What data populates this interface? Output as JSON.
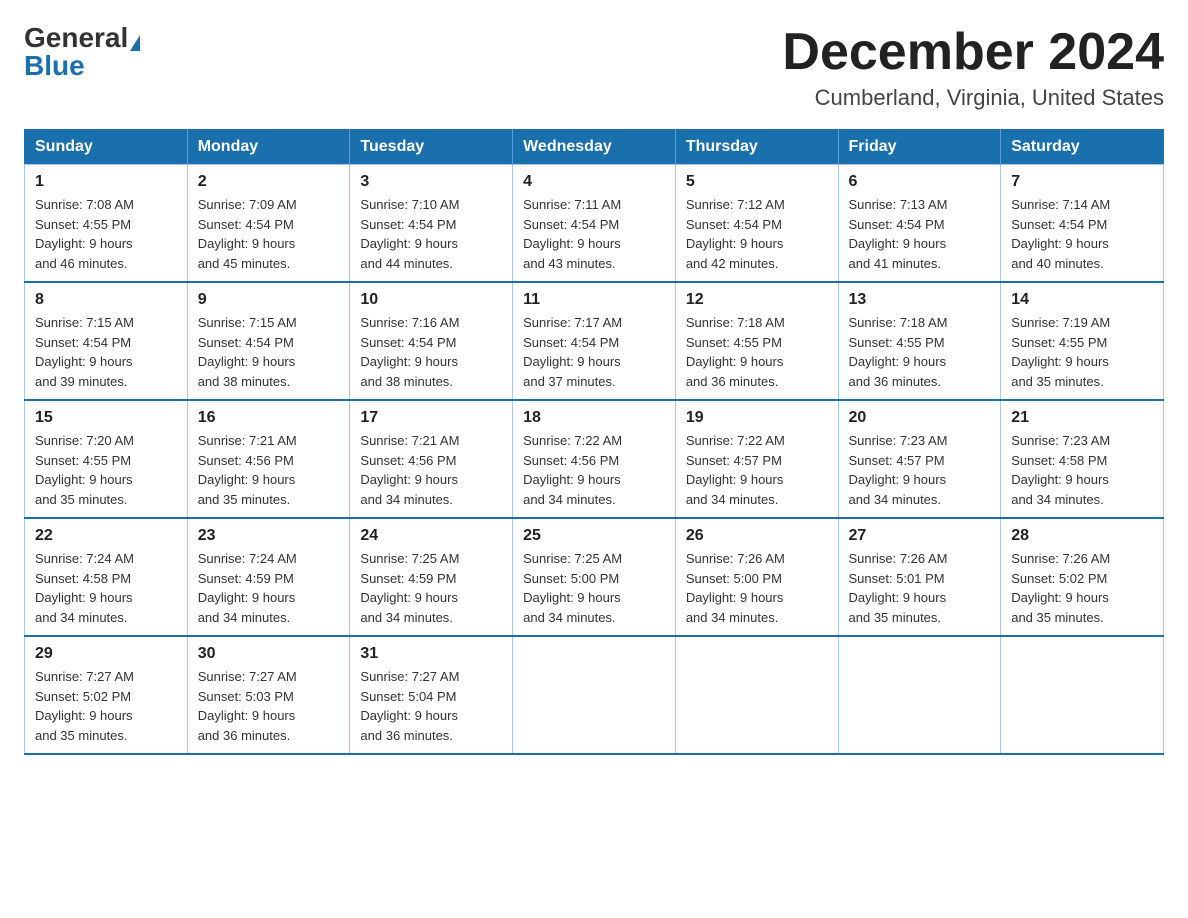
{
  "logo": {
    "general": "General",
    "blue": "Blue"
  },
  "title": "December 2024",
  "subtitle": "Cumberland, Virginia, United States",
  "weekdays": [
    "Sunday",
    "Monday",
    "Tuesday",
    "Wednesday",
    "Thursday",
    "Friday",
    "Saturday"
  ],
  "weeks": [
    [
      {
        "day": "1",
        "sunrise": "7:08 AM",
        "sunset": "4:55 PM",
        "daylight": "9 hours and 46 minutes."
      },
      {
        "day": "2",
        "sunrise": "7:09 AM",
        "sunset": "4:54 PM",
        "daylight": "9 hours and 45 minutes."
      },
      {
        "day": "3",
        "sunrise": "7:10 AM",
        "sunset": "4:54 PM",
        "daylight": "9 hours and 44 minutes."
      },
      {
        "day": "4",
        "sunrise": "7:11 AM",
        "sunset": "4:54 PM",
        "daylight": "9 hours and 43 minutes."
      },
      {
        "day": "5",
        "sunrise": "7:12 AM",
        "sunset": "4:54 PM",
        "daylight": "9 hours and 42 minutes."
      },
      {
        "day": "6",
        "sunrise": "7:13 AM",
        "sunset": "4:54 PM",
        "daylight": "9 hours and 41 minutes."
      },
      {
        "day": "7",
        "sunrise": "7:14 AM",
        "sunset": "4:54 PM",
        "daylight": "9 hours and 40 minutes."
      }
    ],
    [
      {
        "day": "8",
        "sunrise": "7:15 AM",
        "sunset": "4:54 PM",
        "daylight": "9 hours and 39 minutes."
      },
      {
        "day": "9",
        "sunrise": "7:15 AM",
        "sunset": "4:54 PM",
        "daylight": "9 hours and 38 minutes."
      },
      {
        "day": "10",
        "sunrise": "7:16 AM",
        "sunset": "4:54 PM",
        "daylight": "9 hours and 38 minutes."
      },
      {
        "day": "11",
        "sunrise": "7:17 AM",
        "sunset": "4:54 PM",
        "daylight": "9 hours and 37 minutes."
      },
      {
        "day": "12",
        "sunrise": "7:18 AM",
        "sunset": "4:55 PM",
        "daylight": "9 hours and 36 minutes."
      },
      {
        "day": "13",
        "sunrise": "7:18 AM",
        "sunset": "4:55 PM",
        "daylight": "9 hours and 36 minutes."
      },
      {
        "day": "14",
        "sunrise": "7:19 AM",
        "sunset": "4:55 PM",
        "daylight": "9 hours and 35 minutes."
      }
    ],
    [
      {
        "day": "15",
        "sunrise": "7:20 AM",
        "sunset": "4:55 PM",
        "daylight": "9 hours and 35 minutes."
      },
      {
        "day": "16",
        "sunrise": "7:21 AM",
        "sunset": "4:56 PM",
        "daylight": "9 hours and 35 minutes."
      },
      {
        "day": "17",
        "sunrise": "7:21 AM",
        "sunset": "4:56 PM",
        "daylight": "9 hours and 34 minutes."
      },
      {
        "day": "18",
        "sunrise": "7:22 AM",
        "sunset": "4:56 PM",
        "daylight": "9 hours and 34 minutes."
      },
      {
        "day": "19",
        "sunrise": "7:22 AM",
        "sunset": "4:57 PM",
        "daylight": "9 hours and 34 minutes."
      },
      {
        "day": "20",
        "sunrise": "7:23 AM",
        "sunset": "4:57 PM",
        "daylight": "9 hours and 34 minutes."
      },
      {
        "day": "21",
        "sunrise": "7:23 AM",
        "sunset": "4:58 PM",
        "daylight": "9 hours and 34 minutes."
      }
    ],
    [
      {
        "day": "22",
        "sunrise": "7:24 AM",
        "sunset": "4:58 PM",
        "daylight": "9 hours and 34 minutes."
      },
      {
        "day": "23",
        "sunrise": "7:24 AM",
        "sunset": "4:59 PM",
        "daylight": "9 hours and 34 minutes."
      },
      {
        "day": "24",
        "sunrise": "7:25 AM",
        "sunset": "4:59 PM",
        "daylight": "9 hours and 34 minutes."
      },
      {
        "day": "25",
        "sunrise": "7:25 AM",
        "sunset": "5:00 PM",
        "daylight": "9 hours and 34 minutes."
      },
      {
        "day": "26",
        "sunrise": "7:26 AM",
        "sunset": "5:00 PM",
        "daylight": "9 hours and 34 minutes."
      },
      {
        "day": "27",
        "sunrise": "7:26 AM",
        "sunset": "5:01 PM",
        "daylight": "9 hours and 35 minutes."
      },
      {
        "day": "28",
        "sunrise": "7:26 AM",
        "sunset": "5:02 PM",
        "daylight": "9 hours and 35 minutes."
      }
    ],
    [
      {
        "day": "29",
        "sunrise": "7:27 AM",
        "sunset": "5:02 PM",
        "daylight": "9 hours and 35 minutes."
      },
      {
        "day": "30",
        "sunrise": "7:27 AM",
        "sunset": "5:03 PM",
        "daylight": "9 hours and 36 minutes."
      },
      {
        "day": "31",
        "sunrise": "7:27 AM",
        "sunset": "5:04 PM",
        "daylight": "9 hours and 36 minutes."
      },
      null,
      null,
      null,
      null
    ]
  ],
  "labels": {
    "sunrise": "Sunrise:",
    "sunset": "Sunset:",
    "daylight": "Daylight:"
  }
}
